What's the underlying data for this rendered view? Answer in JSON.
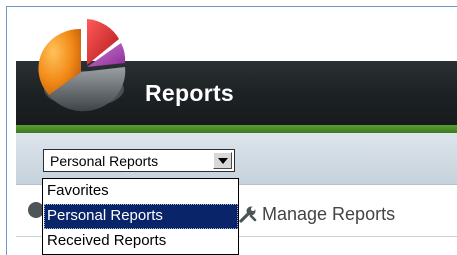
{
  "header": {
    "title": "Reports",
    "logo_icon": "pie-chart-logo-icon"
  },
  "report_filter": {
    "selected_value": "Personal Reports",
    "options": [
      {
        "label": "Favorites",
        "selected": false
      },
      {
        "label": "Personal Reports",
        "selected": true
      },
      {
        "label": "Received Reports",
        "selected": false
      }
    ]
  },
  "actions": {
    "manage_reports_label": "Manage Reports",
    "manage_reports_icon": "wrench-icon"
  },
  "colors": {
    "header_bg": "#1c2123",
    "accent_green": "#4a8c28",
    "toolbar_bg": "#d3dde5",
    "selection_bg": "#0a246a",
    "frame_border": "#6b9ac8"
  }
}
